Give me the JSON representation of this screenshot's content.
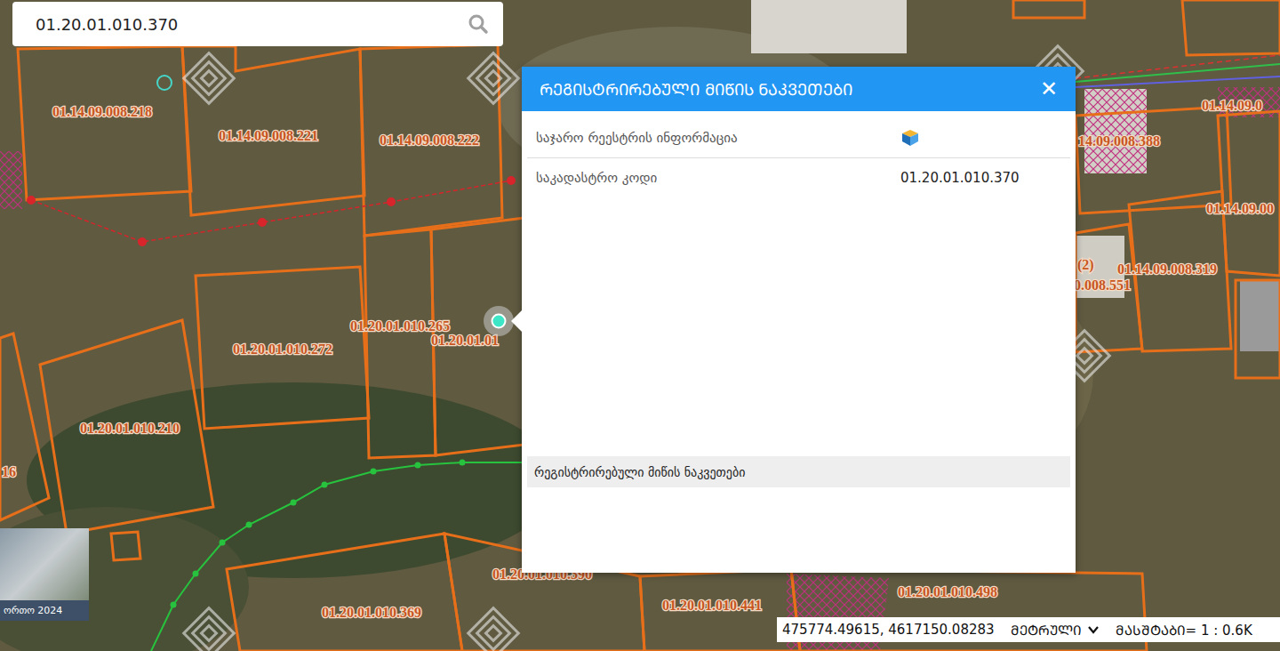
{
  "search": {
    "value": "01.20.01.010.370"
  },
  "popup": {
    "title": "ᲠᲔᲒᲘᲡᲢᲠᲘᲠᲔᲑᲣᲚᲘ ᲛᲘᲬᲘᲡ ᲜᲐᲙᲕᲔᲗᲔᲑᲘ",
    "close": "✕",
    "rows": [
      {
        "label": "საჯარო რეესტრის ინფორმაცია",
        "value": "",
        "kind": "icon"
      },
      {
        "label": "საკადასტრო კოდი",
        "value": "01.20.01.010.370",
        "kind": "text"
      }
    ],
    "section": "რეგისტრირებული მიწის ნაკვეთები"
  },
  "map": {
    "parcel_labels": [
      {
        "label": "01.14.09.008.218"
      },
      {
        "label": "01.14.09.008.221"
      },
      {
        "label": "01.14.09.008.222"
      },
      {
        "label": "01.20.01.010.265"
      },
      {
        "label": "01.20.01.01"
      },
      {
        "label": "01.20.01.010.272"
      },
      {
        "label": "01.20.01.010.210"
      },
      {
        "label": "16"
      },
      {
        "label": "01.20.01.010.369"
      },
      {
        "label": "01.20.01.010.390"
      },
      {
        "label": "01.20.01.010.441"
      },
      {
        "label": "01.20.01.010.498"
      },
      {
        "label": "14.09.008.388"
      },
      {
        "label": "01.14.09.0"
      },
      {
        "label": "01.14.09.00"
      },
      {
        "label": "(2)"
      },
      {
        "label": "01.14.09.008.319"
      },
      {
        "label": "0.008.551"
      }
    ],
    "basemap": {
      "label": "ორთო 2024"
    }
  },
  "status_bar": {
    "coordinates": "475774.49615, 4617150.08283",
    "units": "ᲛᲔᲢᲠᲣᲚᲘ",
    "scale": "ᲛᲐᲡᲨᲢᲐᲑᲘ= 1 : 0.6K"
  }
}
